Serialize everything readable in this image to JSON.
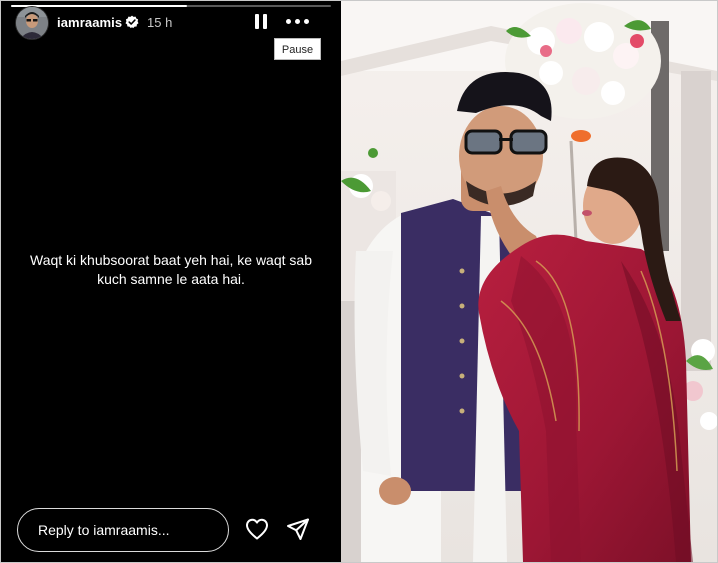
{
  "story": {
    "username": "iamraamis",
    "time": "15 h",
    "verified": true,
    "caption": "Waqt ki khubsoorat baat yeh hai, ke waqt sab kuch samne le aata hai.",
    "progress": 0.55,
    "reply_placeholder": "Reply to iamraamis...",
    "tooltip": "Pause"
  },
  "icons": {
    "pause": "pause-icon",
    "more": "more-options-icon",
    "like": "heart-icon",
    "send": "paper-plane-icon",
    "verified": "verified-badge-icon"
  },
  "colors": {
    "story_bg": "#000000",
    "text": "#ffffff",
    "vest": "#3a2d63",
    "dupatta": "#a11d3a"
  }
}
